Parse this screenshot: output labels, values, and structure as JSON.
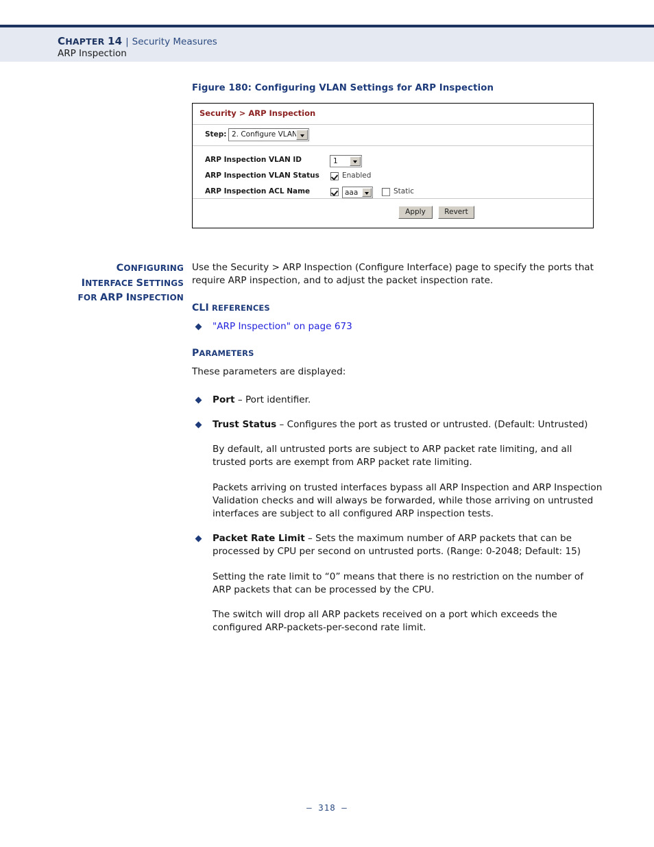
{
  "header": {
    "chapter_prefix": "C",
    "chapter_rest": "HAPTER",
    "chapter_number": "14",
    "separator": "|",
    "section": "Security Measures",
    "subsection": "ARP Inspection"
  },
  "figure": {
    "caption": "Figure 180:  Configuring VLAN Settings for ARP Inspection"
  },
  "panel": {
    "title": "Security > ARP Inspection",
    "step_label": "Step:",
    "step_value": "2. Configure VLAN",
    "fields": [
      {
        "label": "ARP Inspection VLAN ID",
        "value": "1"
      },
      {
        "label": "ARP Inspection VLAN Status",
        "checkbox_label": "Enabled",
        "checked": true
      },
      {
        "label": "ARP Inspection ACL Name",
        "value": "aaa",
        "checked": true,
        "static_label": "Static",
        "static_checked": false
      }
    ],
    "apply_label": "Apply",
    "revert_label": "Revert"
  },
  "margin_heading": {
    "line1_cap": "C",
    "line1_rest": "ONFIGURING",
    "line2_cap1": "I",
    "line2_rest1": "NTERFACE",
    "line2_cap2": "S",
    "line2_rest2": "ETTINGS",
    "line3_pre": "FOR",
    "line3_arp": "ARP",
    "line3_cap": "I",
    "line3_rest": "NSPECTION"
  },
  "body": {
    "intro": "Use the Security > ARP Inspection (Configure Interface) page to specify the ports that require ARP inspection, and to adjust the packet inspection rate.",
    "cli_heading_cap": "CLI",
    "cli_heading_rest": "REFERENCES",
    "cli_link": "\"ARP Inspection\" on page 673",
    "parameters_heading_cap": "P",
    "parameters_heading_rest": "ARAMETERS",
    "parameters_intro": "These parameters are displayed:",
    "bullets": [
      {
        "term": "Port",
        "dash": " – ",
        "text": "Port identifier."
      },
      {
        "term": "Trust Status",
        "dash": " – ",
        "text": "Configures the port as trusted or untrusted. (Default: Untrusted)",
        "sub_paras": [
          "By default, all untrusted ports are subject to ARP packet rate limiting, and all trusted ports are exempt from ARP packet rate limiting.",
          "Packets arriving on trusted interfaces bypass all ARP Inspection and ARP Inspection Validation checks and will always be forwarded, while those arriving on untrusted interfaces are subject to all configured ARP inspection tests."
        ]
      },
      {
        "term": "Packet Rate Limit",
        "dash": " – ",
        "text": "Sets the maximum number of ARP packets that can be processed by CPU per second on untrusted ports. (Range: 0-2048; Default: 15)",
        "sub_paras": [
          "Setting the rate limit to “0” means that there is no restriction on the number of ARP packets that can be processed by the CPU.",
          "The switch will drop all ARP packets received on a port which exceeds the configured ARP-packets-per-second rate limit."
        ]
      }
    ]
  },
  "footer": {
    "page_number": "–  318  –"
  },
  "colors": {
    "navy": "#1d3461",
    "heading_blue": "#1d3a7a",
    "link_blue": "#2222dd",
    "panel_title_red": "#8b2020",
    "header_band": "#e4e9f2"
  }
}
